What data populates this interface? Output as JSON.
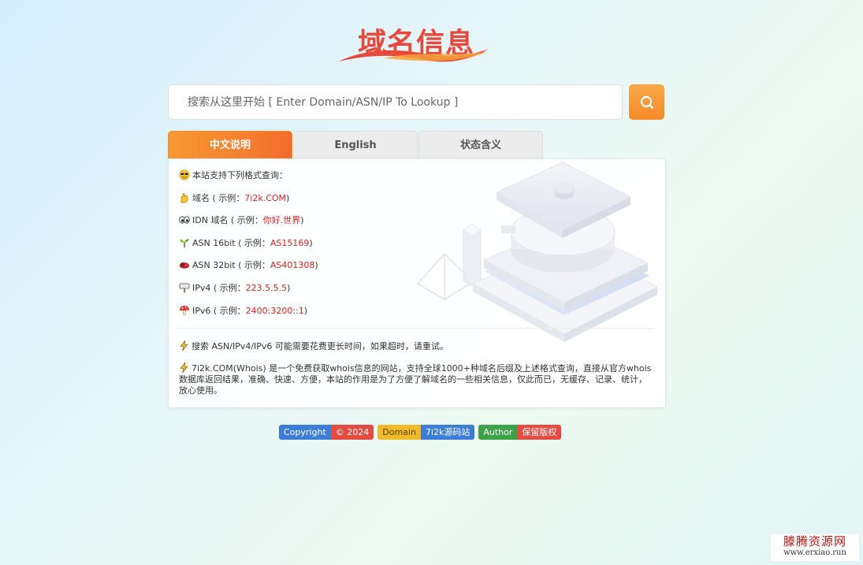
{
  "logo": {
    "text": "域名信息"
  },
  "search": {
    "placeholder": "搜索从这里开始 [ Enter Domain/ASN/IP To Lookup ]",
    "value": ""
  },
  "tabs": [
    {
      "label": "中文说明",
      "active": true
    },
    {
      "label": "English",
      "active": false
    },
    {
      "label": "状态含义",
      "active": false
    }
  ],
  "intro": {
    "icon": "smiling-face-sunglasses-icon",
    "text": "本站支持下列格式查询："
  },
  "formats": [
    {
      "icon": "hand-icon",
      "label": "域名 ( 示例：",
      "example": "7i2k.COM",
      "suffix": " )"
    },
    {
      "icon": "eyes-icon",
      "label": "IDN 域名 ( 示例：",
      "example": "你好.世界",
      "suffix": " )"
    },
    {
      "icon": "sprout-icon",
      "label": "ASN 16bit ( 示例：",
      "example": "AS15169",
      "suffix": " )"
    },
    {
      "icon": "cake-icon",
      "label": "ASN 32bit ( 示例：",
      "example": "AS401308",
      "suffix": " )"
    },
    {
      "icon": "signpost-icon",
      "label": "IPv4 ( 示例：",
      "example": "223.5.5.5",
      "suffix": " )"
    },
    {
      "icon": "mushroom-icon",
      "label": "IPv6 ( 示例：",
      "example": "2400:3200::1",
      "suffix": " )"
    }
  ],
  "notes": [
    {
      "icon": "lightning-icon",
      "text": "搜索 ASN/IPv4/IPv6 可能需要花费更长时间，如果超时，请重试。"
    },
    {
      "icon": "lightning-icon",
      "text": "7i2k.COM(Whois) 是一个免费获取whois信息的网站，支持全球1000+种域名后缀及上述格式查询，直接从官方whois数据库返回结果，准确、快速、方便，本站的作用是为了方便了解域名的一些相关信息，仅此而已，无缓存、记录、统计，放心使用。"
    }
  ],
  "badges": [
    {
      "left": "Copyright",
      "right": "© 2024",
      "left_color": "#3e7dd6",
      "right_color": "#e34c41"
    },
    {
      "left": "Domain",
      "right": "7i2k源码站",
      "left_color": "#efbb2b",
      "right_color": "#3e7dd6"
    },
    {
      "left": "Author",
      "right": "保留版权",
      "left_color": "#3da14a",
      "right_color": "#e34c41"
    }
  ],
  "watermark": {
    "title": "滕腾资源网",
    "url": "www.erxiao.run"
  },
  "colors": {
    "accent": "#f58a2a",
    "example_red": "#e02020",
    "logo_red": "#e8483a"
  }
}
